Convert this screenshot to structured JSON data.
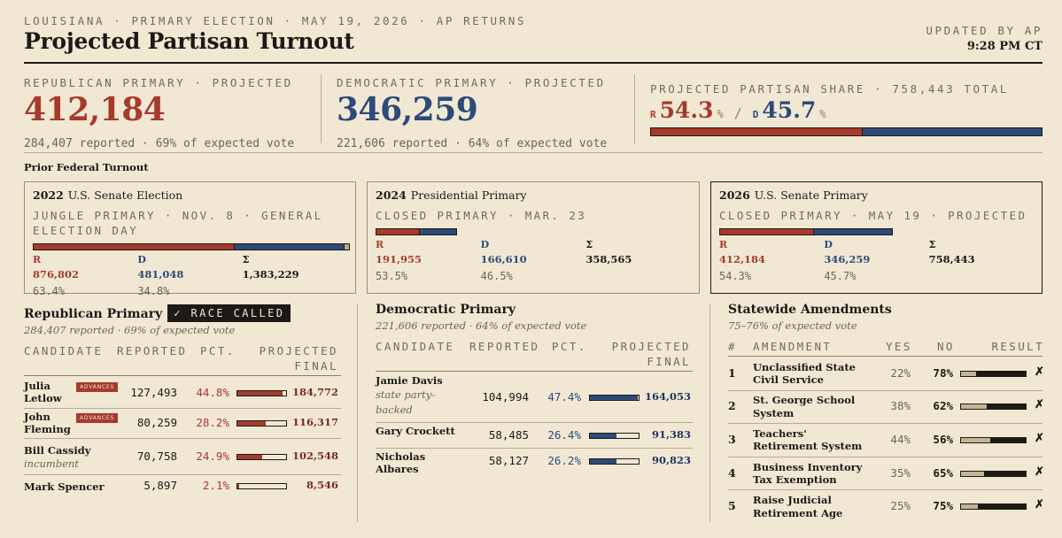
{
  "header": {
    "kicker": "LOUISIANA · PRIMARY ELECTION · MAY 19, 2026 · AP RETURNS",
    "title": "Projected Partisan Turnout",
    "updated_label": "UPDATED BY AP",
    "updated_time": "9:28 PM CT"
  },
  "republican": {
    "label": "REPUBLICAN PRIMARY · PROJECTED",
    "total": "412,184",
    "sub": "284,407 reported · 69% of expected vote"
  },
  "democratic": {
    "label": "DEMOCRATIC PRIMARY · PROJECTED",
    "total": "346,259",
    "sub": "221,606 reported · 64% of expected vote"
  },
  "share": {
    "label": "PROJECTED PARTISAN SHARE · 758,443 TOTAL",
    "r_letter": "R",
    "r_value": "54.3",
    "d_letter": "D",
    "d_value": "45.7",
    "pct_sign": "%",
    "slash": "/",
    "r_fraction": 0.543
  },
  "prior": {
    "heading": "Prior Federal Turnout",
    "cards": [
      {
        "year": "2022",
        "name": "U.S. Senate Election",
        "kicker": "JUNGLE PRIMARY · NOV. 8 · GENERAL ELECTION DAY",
        "r_label": "R",
        "d_label": "D",
        "t_label": "Σ",
        "r_value": "876,802",
        "d_value": "481,048",
        "t_value": "1,383,229",
        "r_pct": "63.4%",
        "d_pct": "34.8%",
        "r_frac": 0.634,
        "d_frac": 0.348
      },
      {
        "year": "2024",
        "name": "Presidential Primary",
        "kicker": "CLOSED PRIMARY · MAR. 23",
        "r_label": "R",
        "d_label": "D",
        "t_label": "Σ",
        "r_value": "191,955",
        "d_value": "166,610",
        "t_value": "358,565",
        "r_pct": "53.5%",
        "d_pct": "46.5%",
        "r_frac": 0.535,
        "d_frac": 0.465
      },
      {
        "year": "2026",
        "name": "U.S. Senate Primary",
        "kicker": "CLOSED PRIMARY · MAY 19 · PROJECTED",
        "r_label": "R",
        "d_label": "D",
        "t_label": "Σ",
        "r_value": "412,184",
        "d_value": "346,259",
        "t_value": "758,443",
        "r_pct": "54.3%",
        "d_pct": "45.7%",
        "r_frac": 0.543,
        "d_frac": 0.457
      }
    ]
  },
  "rep_race": {
    "title": "Republican Primary",
    "badge": "✓ RACE CALLED",
    "sub": "284,407 reported · 69% of expected vote",
    "columns": [
      "CANDIDATE",
      "REPORTED",
      "PCT.",
      "PROJECTED FINAL"
    ],
    "rows": [
      {
        "name": "Julia Letlow",
        "tag": "ADVANCES",
        "note": "",
        "reported": "127,493",
        "pct": "44.8%",
        "final": "184,772",
        "frac": 0.448
      },
      {
        "name": "John Fleming",
        "tag": "ADVANCES",
        "note": "",
        "reported": "80,259",
        "pct": "28.2%",
        "final": "116,317",
        "frac": 0.282
      },
      {
        "name": "Bill Cassidy",
        "tag": "",
        "note": "incumbent",
        "reported": "70,758",
        "pct": "24.9%",
        "final": "102,548",
        "frac": 0.249
      },
      {
        "name": "Mark Spencer",
        "tag": "",
        "note": "",
        "reported": "5,897",
        "pct": "2.1%",
        "final": "8,546",
        "frac": 0.021
      }
    ]
  },
  "dem_race": {
    "title": "Democratic Primary",
    "sub": "221,606 reported · 64% of expected vote",
    "columns": [
      "CANDIDATE",
      "REPORTED",
      "PCT.",
      "PROJECTED FINAL"
    ],
    "rows": [
      {
        "name": "Jamie Davis",
        "note": "state party-backed",
        "reported": "104,994",
        "pct": "47.4%",
        "final": "164,053",
        "frac": 0.474
      },
      {
        "name": "Gary Crockett",
        "note": "",
        "reported": "58,485",
        "pct": "26.4%",
        "final": "91,383",
        "frac": 0.264
      },
      {
        "name": "Nicholas Albares",
        "note": "",
        "reported": "58,127",
        "pct": "26.2%",
        "final": "90,823",
        "frac": 0.262
      }
    ]
  },
  "amendments": {
    "title": "Statewide Amendments",
    "sub": "75–76% of expected vote",
    "columns": [
      "#",
      "AMENDMENT",
      "YES",
      "NO",
      "RESULT"
    ],
    "rows": [
      {
        "num": "1",
        "name": "Unclassified State Civil Service",
        "yes": "22%",
        "no": "78%",
        "result": "✗",
        "yes_frac": 0.22
      },
      {
        "num": "2",
        "name": "St. George School System",
        "yes": "38%",
        "no": "62%",
        "result": "✗",
        "yes_frac": 0.38
      },
      {
        "num": "3",
        "name": "Teachers' Retirement System",
        "yes": "44%",
        "no": "56%",
        "result": "✗",
        "yes_frac": 0.44
      },
      {
        "num": "4",
        "name": "Business Inventory Tax Exemption",
        "yes": "35%",
        "no": "65%",
        "result": "✗",
        "yes_frac": 0.35
      },
      {
        "num": "5",
        "name": "Raise Judicial Retirement Age",
        "yes": "25%",
        "no": "75%",
        "result": "✗",
        "yes_frac": 0.25
      }
    ]
  },
  "colors": {
    "republican": "#a63a2c",
    "democratic": "#2d4a78",
    "background": "#f1e8d4",
    "yes_bar": "#c4b492",
    "no_bar": "#1c1a16"
  }
}
